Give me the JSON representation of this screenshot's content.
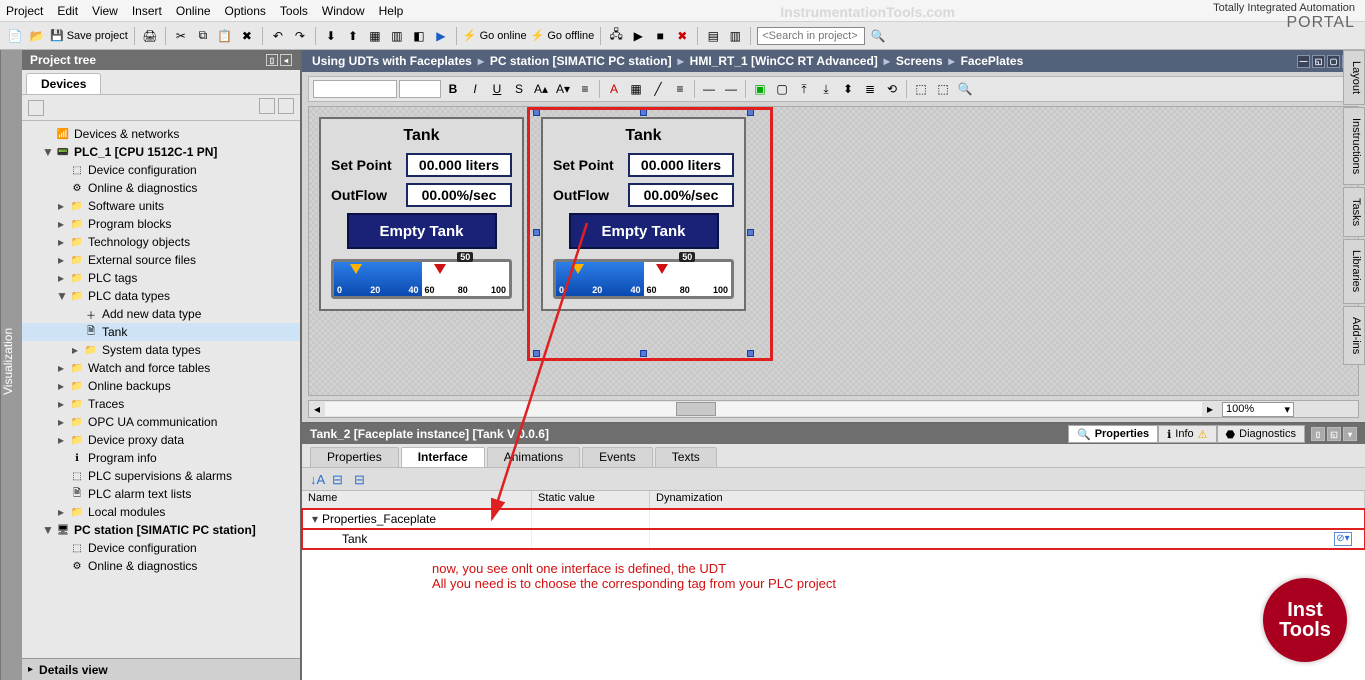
{
  "menu": [
    "Project",
    "Edit",
    "View",
    "Insert",
    "Online",
    "Options",
    "Tools",
    "Window",
    "Help"
  ],
  "title_right": {
    "line1": "Totally Integrated Automation",
    "portal": "PORTAL"
  },
  "watermark": "InstrumentationTools.com",
  "toolbar": {
    "save_project": "Save project",
    "go_online": "Go online",
    "go_offline": "Go offline",
    "search_placeholder": "<Search in project>"
  },
  "side_left": "Visualization",
  "project_panel": {
    "title": "Project tree",
    "devices_tab": "Devices"
  },
  "tree": [
    {
      "lvl": 1,
      "tw": "",
      "ico": "📶",
      "label": "Devices & networks"
    },
    {
      "lvl": 1,
      "tw": "▼",
      "ico": "📟",
      "label": "PLC_1 [CPU 1512C-1 PN]",
      "bold": true
    },
    {
      "lvl": 2,
      "tw": "",
      "ico": "⬚",
      "label": "Device configuration"
    },
    {
      "lvl": 2,
      "tw": "",
      "ico": "⚙",
      "label": "Online & diagnostics"
    },
    {
      "lvl": 2,
      "tw": "▸",
      "ico": "📁",
      "label": "Software units"
    },
    {
      "lvl": 2,
      "tw": "▸",
      "ico": "📁",
      "label": "Program blocks"
    },
    {
      "lvl": 2,
      "tw": "▸",
      "ico": "📁",
      "label": "Technology objects"
    },
    {
      "lvl": 2,
      "tw": "▸",
      "ico": "📁",
      "label": "External source files"
    },
    {
      "lvl": 2,
      "tw": "▸",
      "ico": "📁",
      "label": "PLC tags"
    },
    {
      "lvl": 2,
      "tw": "▼",
      "ico": "📁",
      "label": "PLC data types"
    },
    {
      "lvl": 3,
      "tw": "",
      "ico": "＋",
      "label": "Add new data type"
    },
    {
      "lvl": 3,
      "tw": "",
      "ico": "🗎",
      "label": "Tank",
      "selected": true
    },
    {
      "lvl": 3,
      "tw": "▸",
      "ico": "📁",
      "label": "System data types"
    },
    {
      "lvl": 2,
      "tw": "▸",
      "ico": "📁",
      "label": "Watch and force tables"
    },
    {
      "lvl": 2,
      "tw": "▸",
      "ico": "📁",
      "label": "Online backups"
    },
    {
      "lvl": 2,
      "tw": "▸",
      "ico": "📁",
      "label": "Traces"
    },
    {
      "lvl": 2,
      "tw": "▸",
      "ico": "📁",
      "label": "OPC UA communication"
    },
    {
      "lvl": 2,
      "tw": "▸",
      "ico": "📁",
      "label": "Device proxy data"
    },
    {
      "lvl": 2,
      "tw": "",
      "ico": "ℹ",
      "label": "Program info"
    },
    {
      "lvl": 2,
      "tw": "",
      "ico": "⬚",
      "label": "PLC supervisions & alarms"
    },
    {
      "lvl": 2,
      "tw": "",
      "ico": "🗎",
      "label": "PLC alarm text lists"
    },
    {
      "lvl": 2,
      "tw": "▸",
      "ico": "📁",
      "label": "Local modules"
    },
    {
      "lvl": 1,
      "tw": "▼",
      "ico": "🖥",
      "label": "PC station [SIMATIC PC station]",
      "bold": true
    },
    {
      "lvl": 2,
      "tw": "",
      "ico": "⬚",
      "label": "Device configuration"
    },
    {
      "lvl": 2,
      "tw": "",
      "ico": "⚙",
      "label": "Online & diagnostics"
    }
  ],
  "details_view": "Details view",
  "breadcrumb": [
    "Using UDTs with Faceplates",
    "PC station [SIMATIC PC station]",
    "HMI_RT_1 [WinCC RT Advanced]",
    "Screens",
    "FacePlates"
  ],
  "faceplate": {
    "title": "Tank",
    "set_point_label": "Set Point",
    "set_point_value": "00.000 liters",
    "outflow_label": "OutFlow",
    "outflow_value": "00.00%/sec",
    "empty_button": "Empty Tank",
    "gauge_mid": "50",
    "gauge_blue_ticks": [
      "0",
      "20",
      "40"
    ],
    "gauge_white_ticks": [
      "60",
      "80",
      "100"
    ]
  },
  "zoom": "100%",
  "inspector": {
    "title": "Tank_2 [Faceplate instance] [Tank V 0.0.6]",
    "tabs": {
      "properties": "Properties",
      "info": "Info",
      "diagnostics": "Diagnostics"
    },
    "subtabs": {
      "properties": "Properties",
      "interface": "Interface",
      "animations": "Animations",
      "events": "Events",
      "texts": "Texts"
    },
    "columns": {
      "name": "Name",
      "static": "Static value",
      "dyn": "Dynamization"
    },
    "row_group": "Properties_Faceplate",
    "row_tank": "Tank"
  },
  "side_right": [
    "Layout",
    "Instructions",
    "Tasks",
    "Libraries",
    "Add-ins"
  ],
  "annotation": {
    "line1": "now, you see onlt one interface is defined, the UDT",
    "line2": "All you need is to choose the corresponding tag from your PLC project"
  },
  "badge": {
    "l1": "Inst",
    "l2": "Tools"
  }
}
